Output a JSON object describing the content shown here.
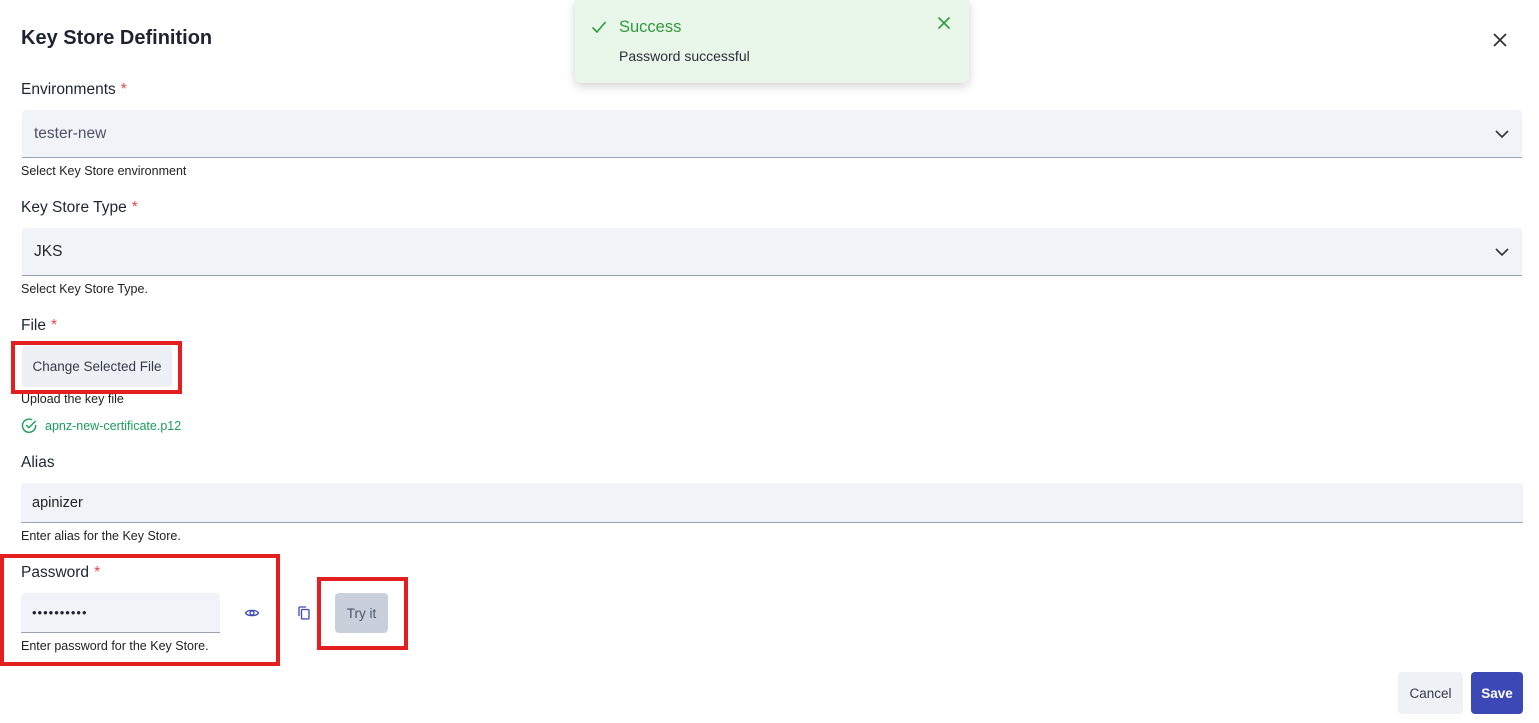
{
  "dialog": {
    "title": "Key Store Definition"
  },
  "environments": {
    "label": "Environments",
    "required_mark": "*",
    "value": "tester-new",
    "helper": "Select Key Store environment"
  },
  "keystore_type": {
    "label": "Key Store Type",
    "required_mark": "*",
    "value": "JKS",
    "helper": "Select Key Store Type."
  },
  "file": {
    "label": "File",
    "required_mark": "*",
    "button_label": "Change Selected File",
    "helper": "Upload the key file",
    "selected_filename": "apnz-new-certificate.p12"
  },
  "alias": {
    "label": "Alias",
    "value": "apinizer",
    "helper": "Enter alias for the Key Store."
  },
  "password": {
    "label": "Password",
    "required_mark": "*",
    "masked_value": "••••••••••",
    "helper": "Enter password for the Key Store.",
    "try_label": "Try it"
  },
  "footer": {
    "cancel_label": "Cancel",
    "save_label": "Save"
  },
  "toast": {
    "title": "Success",
    "message": "Password successful"
  },
  "colors": {
    "accent": "#3b48b6",
    "success": "#2f9a3c",
    "highlight_box": "#e31f1f",
    "required": "#e5484d"
  }
}
